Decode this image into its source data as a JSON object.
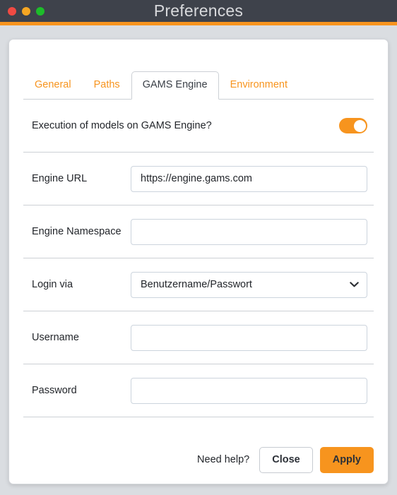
{
  "window": {
    "title": "Preferences",
    "accent_color": "#f7941e",
    "titlebar_color": "#3e424b",
    "traffic_lights": [
      {
        "name": "close",
        "color": "#f04a43"
      },
      {
        "name": "minimize",
        "color": "#f5a623"
      },
      {
        "name": "zoom",
        "color": "#1dbd2a"
      }
    ]
  },
  "tabs": [
    {
      "label": "General",
      "active": false
    },
    {
      "label": "Paths",
      "active": false
    },
    {
      "label": "GAMS Engine",
      "active": true
    },
    {
      "label": "Environment",
      "active": false
    }
  ],
  "form": {
    "execution_toggle": {
      "label": "Execution of models on GAMS Engine?",
      "state": "on"
    },
    "engine_url": {
      "label": "Engine URL",
      "value": "https://engine.gams.com",
      "placeholder": ""
    },
    "engine_namespace": {
      "label": "Engine Namespace",
      "value": "",
      "placeholder": ""
    },
    "login_via": {
      "label": "Login via",
      "value": "Benutzername/Passwort",
      "options": [
        "Benutzername/Passwort"
      ],
      "chevron_icon": "chevron-down-icon"
    },
    "username": {
      "label": "Username",
      "value": "",
      "placeholder": ""
    },
    "password": {
      "label": "Password",
      "value": "",
      "placeholder": ""
    }
  },
  "footer": {
    "need_help": "Need help?",
    "close_label": "Close",
    "apply_label": "Apply"
  }
}
